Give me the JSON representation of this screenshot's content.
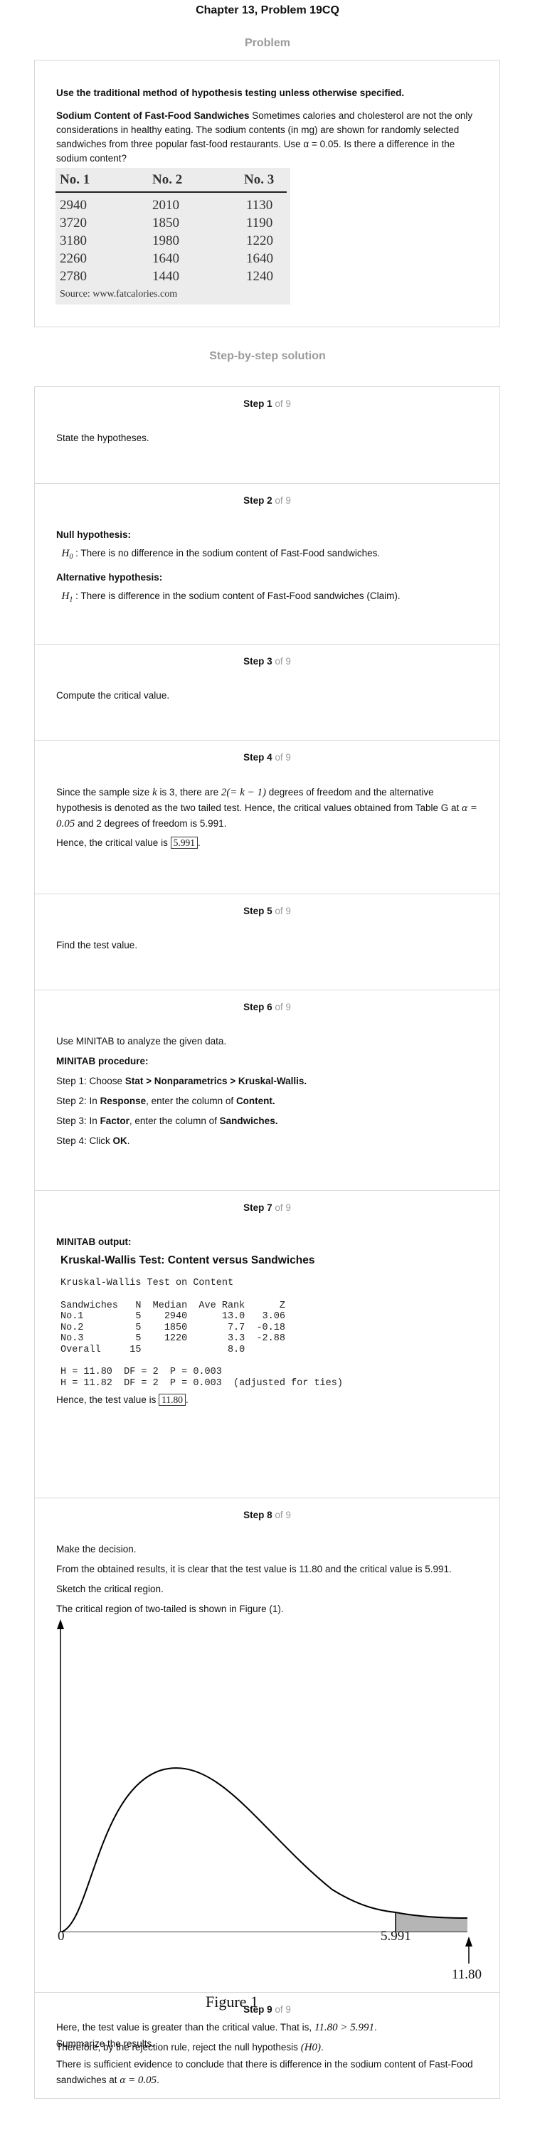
{
  "header": {
    "title": "Chapter 13, Problem 19CQ",
    "problem_label": "Problem",
    "solution_label": "Step-by-step solution"
  },
  "problem": {
    "instruction": "Use the traditional method of hypothesis testing unless otherwise specified.",
    "lead": "Sodium Content of Fast-Food Sandwiches",
    "text": "Sometimes calories and cholesterol are not the only considerations in healthy eating. The sodium contents (in mg) are shown for randomly selected sandwiches from three popular fast-food restaurants. Use α = 0.05. Is there a difference in the sodium content?",
    "table": {
      "headers": [
        "No. 1",
        "No. 2",
        "No. 3"
      ],
      "rows": [
        [
          "2940",
          "2010",
          "1130"
        ],
        [
          "3720",
          "1850",
          "1190"
        ],
        [
          "3180",
          "1980",
          "1220"
        ],
        [
          "2260",
          "1640",
          "1640"
        ],
        [
          "2780",
          "1440",
          "1240"
        ]
      ],
      "source": "Source: www.fatcalories.com"
    }
  },
  "steps": [
    {
      "num": "Step 1",
      "of": "of 9",
      "text": "State the hypotheses."
    },
    {
      "num": "Step 2",
      "of": "of 9",
      "null_label": "Null hypothesis:",
      "null_sym": "H",
      "null_sub": "0",
      "null_text": "There is no difference in the sodium content of Fast-Food sandwiches.",
      "alt_label": "Alternative hypothesis:",
      "alt_sym": "H",
      "alt_sub": "1",
      "alt_text": "There is difference in the sodium content of Fast-Food sandwiches (Claim)."
    },
    {
      "num": "Step 3",
      "of": "of 9",
      "text": "Compute the critical value."
    },
    {
      "num": "Step 4",
      "of": "of 9",
      "t1": "Since the sample size",
      "k": "k",
      "t2": "is 3, there are",
      "df_expr": "2(= k − 1)",
      "t3": "degrees of freedom and the alternative hypothesis is denoted as the two tailed test. Hence, the critical values obtained from Table G at",
      "alpha_expr": "α = 0.05",
      "t4": "and 2 degrees of freedom is 5.991.",
      "t5": "Hence, the critical value is",
      "crit": "5.991",
      "period": "."
    },
    {
      "num": "Step 5",
      "of": "of 9",
      "text": "Find the test value."
    },
    {
      "num": "Step 6",
      "of": "of 9",
      "intro": "Use MINITAB to analyze the given data.",
      "proc": "MINITAB procedure:",
      "s1a": "Step 1: Choose",
      "s1b": "Stat > Nonparametrics > Kruskal-Wallis.",
      "s2a": "Step 2: In",
      "s2b": "Response",
      "s2c": ", enter the column of",
      "s2d": "Content.",
      "s3a": "Step 3: In",
      "s3b": "Factor",
      "s3c": ", enter the column of",
      "s3d": "Sandwiches.",
      "s4a": "Step 4: Click",
      "s4b": "OK",
      "s4c": "."
    },
    {
      "num": "Step 7",
      "of": "of 9",
      "out_label": "MINITAB output:",
      "test_title": "Kruskal-Wallis Test: Content versus Sandwiches",
      "sub": "Kruskal-Wallis Test on Content",
      "table": "Sandwiches   N  Median  Ave Rank      Z\nNo.1         5    2940      13.0   3.06\nNo.2         5    1850       7.7  -0.18\nNo.3         5    1220       3.3  -2.88\nOverall     15               8.0",
      "h1": "H = 11.80  DF = 2  P = 0.003",
      "h2": "H = 11.82  DF = 2  P = 0.003  (adjusted for ties)",
      "t1": "Hence, the test value is",
      "test_val": "11.80",
      "period": "."
    },
    {
      "num": "Step 8",
      "of": "of 9",
      "d1": "Make the decision.",
      "d2": "From the obtained results, it is clear that the test value is 11.80 and the critical value is 5.991.",
      "d3": "Sketch the critical region.",
      "d4": "The critical region of two-tailed is shown in Figure (1).",
      "fig_zero": "0",
      "fig_crit": "5.991",
      "fig_test": "11.80",
      "fig_caption": "Figure 1",
      "d5": "Here, the test value is greater than the critical value. That is,",
      "ineq": "11.80 > 5.991",
      "d6": "Therefore, by the rejection rule, reject the null hypothesis",
      "h0": "(H0)"
    },
    {
      "num": "Step 9",
      "of": "of 9",
      "text": "Summarize the results.",
      "concl": "There is sufficient evidence to conclude that there is difference in the sodium content of Fast-Food sandwiches at",
      "alpha": "α = 0.05"
    }
  ]
}
